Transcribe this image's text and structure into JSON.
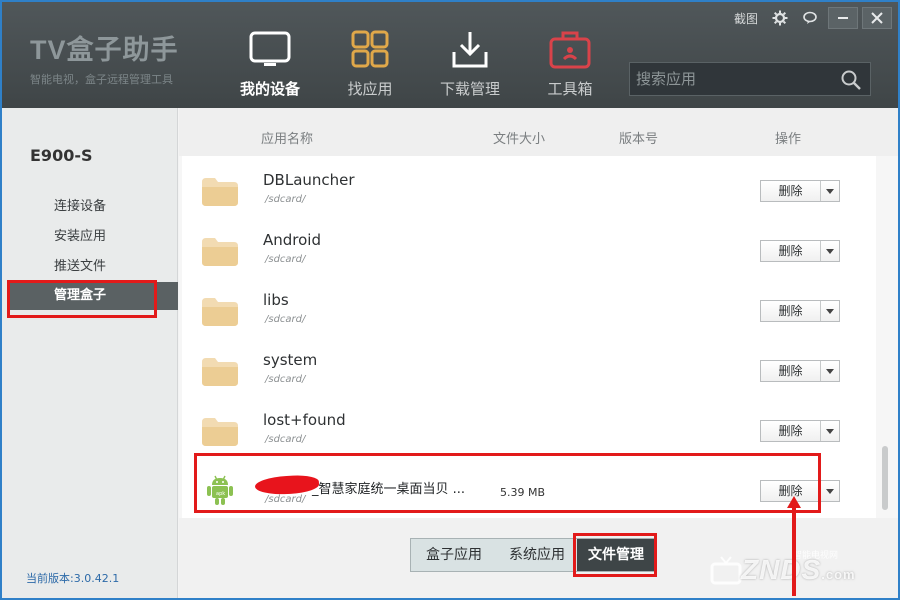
{
  "logo": {
    "title": "TV盒子助手",
    "subtitle": "智能电视，盒子远程管理工具"
  },
  "nav": [
    {
      "label": "我的设备",
      "icon": "tv-icon"
    },
    {
      "label": "找应用",
      "icon": "grid-icon"
    },
    {
      "label": "下载管理",
      "icon": "download-icon"
    },
    {
      "label": "工具箱",
      "icon": "toolbox-icon"
    }
  ],
  "search": {
    "placeholder": "搜索应用"
  },
  "window": {
    "screenshot_label": "截图"
  },
  "sidebar": {
    "device": "E900-S",
    "items": [
      {
        "label": "连接设备"
      },
      {
        "label": "安装应用"
      },
      {
        "label": "推送文件"
      },
      {
        "label": "管理盒子"
      }
    ],
    "version": "当前版本:3.0.42.1"
  },
  "table": {
    "headers": {
      "name": "应用名称",
      "size": "文件大小",
      "version": "版本号",
      "action": "操作"
    },
    "rows": [
      {
        "name": "DBLauncher",
        "path": "/sdcard/",
        "size": "",
        "action": "删除"
      },
      {
        "name": "Android",
        "path": "/sdcard/",
        "size": "",
        "action": "删除"
      },
      {
        "name": "libs",
        "path": "/sdcard/",
        "size": "",
        "action": "删除"
      },
      {
        "name": "system",
        "path": "/sdcard/",
        "size": "",
        "action": "删除"
      },
      {
        "name": "lost+found",
        "path": "/sdcard/",
        "size": "",
        "action": "删除"
      },
      {
        "name": "_智慧家庭统一桌面当贝 ...",
        "path": "/sdcard/",
        "size": "5.39 MB",
        "action": "删除"
      }
    ]
  },
  "tabs": [
    {
      "label": "盒子应用"
    },
    {
      "label": "系统应用"
    },
    {
      "label": "文件管理"
    }
  ],
  "watermark": {
    "main": "ZNDS",
    "small": "智能电视网",
    "suffix": ".com"
  },
  "colors": {
    "accent_red": "#e21a1a",
    "header_bg": "#464c4f",
    "sidebar_active": "#5a6163"
  }
}
